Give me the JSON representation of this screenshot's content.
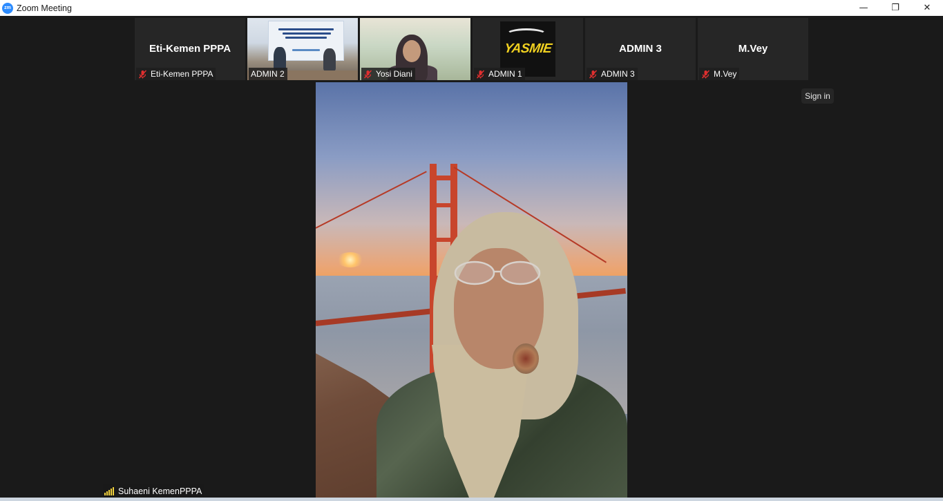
{
  "window": {
    "logo_text": "zm",
    "title": "Zoom Meeting",
    "controls": {
      "minimize": "—",
      "restore": "❐",
      "close": "✕"
    }
  },
  "participants": [
    {
      "display_name": "Eti-Kemen PPPA",
      "label": "Eti-Kemen PPPA",
      "video": false,
      "muted": true
    },
    {
      "display_name": "",
      "label": "ADMIN 2",
      "video": true,
      "muted": false
    },
    {
      "display_name": "",
      "label": "Yosi Diani",
      "video": true,
      "muted": true
    },
    {
      "display_name": "",
      "label": "ADMIN 1",
      "video": true,
      "muted": true,
      "avatar_text": "YASMIE"
    },
    {
      "display_name": "ADMIN 3",
      "label": "ADMIN 3",
      "video": false,
      "muted": true
    },
    {
      "display_name": "M.Vey",
      "label": "M.Vey",
      "video": false,
      "muted": true
    }
  ],
  "active_speaker": {
    "name": "Suhaeni KemenPPPA",
    "signal_icon": "signal-bars-icon"
  },
  "sign_in_label": "Sign in",
  "colors": {
    "mute_red": "#e02f2f",
    "signal_yellow": "#f2d23c",
    "stage_bg": "#1a1a1a",
    "tile_bg": "#262626"
  }
}
